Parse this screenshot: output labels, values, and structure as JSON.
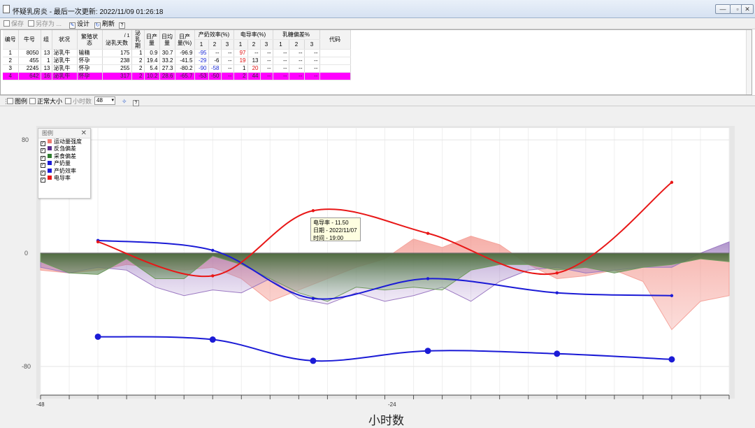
{
  "window": {
    "title": "怀疑乳房炎 - 最后一次更新: 2022/11/09 01:26:18",
    "buttons": [
      "—",
      "▫",
      "✕"
    ]
  },
  "toolbar": {
    "save": "保存",
    "save_as": "另存为 ...",
    "design": "设计",
    "refresh": "刷新",
    "help": "?"
  },
  "table": {
    "headers": {
      "id": "编号",
      "cow": "牛号",
      "group": "组",
      "status": "状况",
      "repro": "繁殖状态",
      "dim": "泌乳天数",
      "lact": "泌乳期",
      "daily_yield": "日产量",
      "avg_yield": "日均量",
      "yield_pct": "日产量(%)",
      "eff": "产奶效率(%)",
      "cond": "电导率(%)",
      "fat": "乳糖偏差%",
      "code": "代码"
    },
    "dim_prefix": "/ 1",
    "sub": [
      "1",
      "2",
      "3"
    ],
    "rows": [
      {
        "id": "1",
        "cow": "8050",
        "group": "13",
        "status": "泌乳牛",
        "repro": "输精",
        "dim": "175",
        "lact": "1",
        "yield": "0.9",
        "avg": "30.7",
        "pct": "-96.9",
        "e1": "-95",
        "e2": "--",
        "e3": "--",
        "c1": "97",
        "c2": "--",
        "c3": "--",
        "f1": "--",
        "f2": "--",
        "f3": "--"
      },
      {
        "id": "2",
        "cow": "455",
        "group": "1",
        "status": "泌乳牛",
        "repro": "怀孕",
        "dim": "238",
        "lact": "2",
        "yield": "19.4",
        "avg": "33.2",
        "pct": "-41.5",
        "e1": "-29",
        "e2": "-6",
        "e3": "--",
        "c1": "19",
        "c2": "13",
        "c3": "--",
        "f1": "--",
        "f2": "--",
        "f3": "--"
      },
      {
        "id": "3",
        "cow": "2245",
        "group": "13",
        "status": "泌乳牛",
        "repro": "怀孕",
        "dim": "255",
        "lact": "2",
        "yield": "5.4",
        "avg": "27.3",
        "pct": "-80.2",
        "e1": "-90",
        "e2": "-58",
        "e3": "--",
        "c1": "1",
        "c2": "20",
        "c3": "--",
        "f1": "--",
        "f2": "--",
        "f3": "--"
      },
      {
        "id": "4",
        "cow": "642",
        "group": "16",
        "status": "泌乳牛",
        "repro": "怀孕",
        "dim": "317",
        "lact": "2",
        "yield": "10.2",
        "avg": "28.6",
        "pct": "-65.7",
        "e1": "-53",
        "e2": "-50",
        "e3": "--",
        "c1": "2",
        "c2": "44",
        "c3": "--",
        "f1": "--",
        "f2": "--",
        "f3": "--"
      }
    ]
  },
  "controls": {
    "legend": "图例",
    "normal_size": "正常大小",
    "hours": "小时数",
    "hours_value": "48",
    "help": "?"
  },
  "legend": {
    "title": "图例",
    "close": "✕",
    "items": [
      {
        "label": "运动量强度",
        "color": "#f07b70"
      },
      {
        "label": "反刍偏差",
        "color": "#5a2b8c"
      },
      {
        "label": "采食偏差",
        "color": "#2e7d2e"
      },
      {
        "label": "产奶量",
        "color": "#1b1bd6"
      },
      {
        "label": "产奶效率",
        "color": "#1b1bd6"
      },
      {
        "label": "电导率",
        "color": "#e81717"
      }
    ]
  },
  "tooltip": {
    "line1": "电导率 - 11.50",
    "line2": "日期 - 2022/11/07",
    "line3": "时间 - 19:00"
  },
  "chart_data": {
    "type": "line",
    "xlabel": "小时数",
    "xlim": [
      -48,
      0
    ],
    "ylim": [
      -105,
      100
    ],
    "yticks": [
      80,
      0,
      -80
    ],
    "xticks": [
      -48,
      -24
    ],
    "series": [
      {
        "name": "电导率",
        "color": "#e81717",
        "x": [
          -44,
          -36,
          -29,
          -21,
          -12,
          -4
        ],
        "y": [
          8,
          -16,
          30,
          14,
          -14,
          50
        ]
      },
      {
        "name": "产奶效率",
        "color": "#1b1bd6",
        "x": [
          -44,
          -36,
          -29,
          -21,
          -12,
          -4
        ],
        "y": [
          9,
          2,
          -32,
          -18,
          -28,
          -30
        ]
      },
      {
        "name": "产奶量",
        "color": "#1b1bd6",
        "x": [
          -44,
          -36,
          -29,
          -21,
          -12,
          -4
        ],
        "y": [
          -59,
          -61,
          -76,
          -69,
          -71,
          -75
        ]
      },
      {
        "name": "采食偏差",
        "color": "#2e7d2e",
        "x": [
          -48,
          -46,
          -44,
          -42,
          -40,
          -38,
          -36,
          -34,
          -32,
          -30,
          -28,
          -26,
          -24,
          -22,
          -20,
          -18,
          -16,
          -14,
          -12,
          -10,
          -8,
          -6,
          -4,
          -2,
          0
        ],
        "y": [
          -6,
          -14,
          -15,
          -4,
          -18,
          -18,
          -2,
          -8,
          -18,
          -28,
          -34,
          -24,
          -26,
          -24,
          -26,
          -12,
          -8,
          -8,
          -12,
          -10,
          -14,
          -10,
          -8,
          -4,
          -6
        ]
      },
      {
        "name": "反刍偏差",
        "color": "#7b4fa8",
        "x": [
          -48,
          -46,
          -44,
          -42,
          -40,
          -38,
          -36,
          -34,
          -32,
          -30,
          -28,
          -26,
          -24,
          -22,
          -20,
          -18,
          -16,
          -14,
          -12,
          -10,
          -8,
          -6,
          -4,
          -2,
          0
        ],
        "y": [
          -10,
          -14,
          -10,
          -12,
          -24,
          -30,
          -26,
          -28,
          -18,
          -32,
          -36,
          -28,
          -34,
          -30,
          -24,
          -34,
          -20,
          -12,
          -10,
          -14,
          -12,
          -10,
          -10,
          0,
          8
        ]
      },
      {
        "name": "运动量强度",
        "color": "#f07b70",
        "x": [
          -48,
          -46,
          -44,
          -42,
          -40,
          -38,
          -36,
          -34,
          -32,
          -30,
          -28,
          -26,
          -24,
          -22,
          -20,
          -18,
          -16,
          -14,
          -12,
          -10,
          -8,
          -6,
          -4,
          -2,
          0
        ],
        "y": [
          -12,
          -14,
          -12,
          -8,
          -10,
          -12,
          -10,
          -18,
          -34,
          -26,
          -18,
          -10,
          -4,
          10,
          4,
          12,
          6,
          -8,
          -18,
          -16,
          -12,
          -20,
          -54,
          -34,
          -30
        ]
      }
    ]
  }
}
